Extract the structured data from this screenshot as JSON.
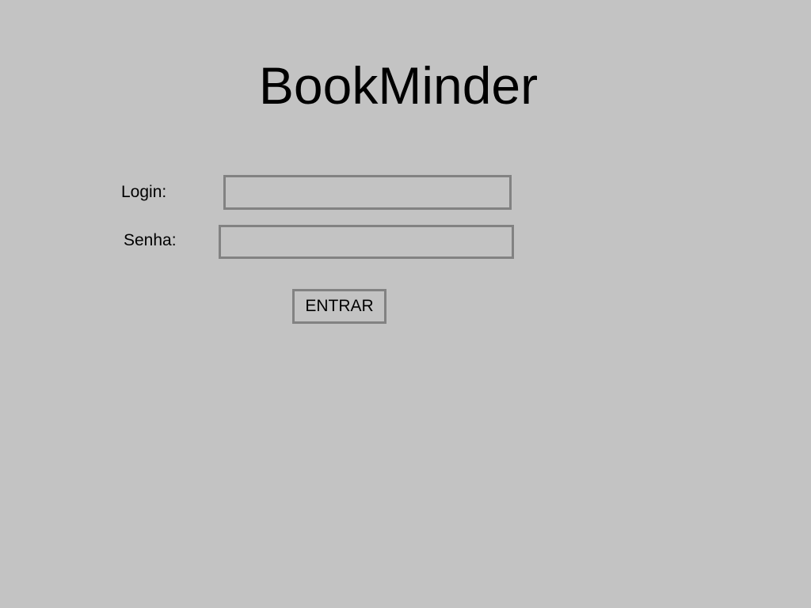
{
  "app": {
    "title": "BookMinder"
  },
  "form": {
    "login_label": "Login:",
    "login_value": "",
    "password_label": "Senha:",
    "password_value": "",
    "submit_label": "ENTRAR"
  },
  "colors": {
    "background": "#c3c3c3",
    "border": "#828282",
    "text": "#000000"
  }
}
